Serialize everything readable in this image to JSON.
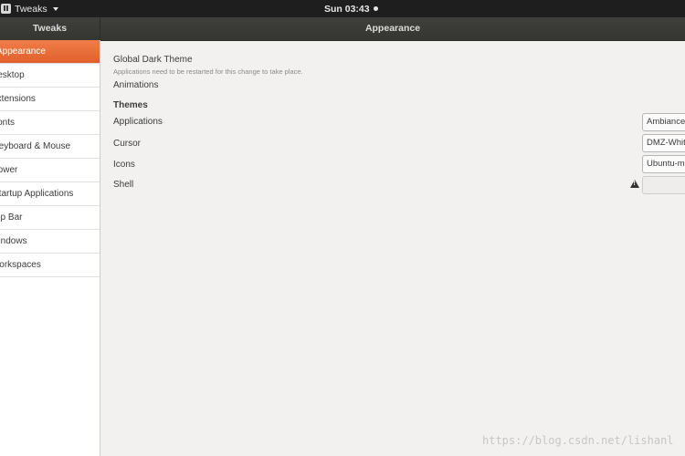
{
  "topbar": {
    "app_name": "Tweaks",
    "clock": "Sun 03:43"
  },
  "header": {
    "sidebar_title": "Tweaks",
    "main_title": "Appearance"
  },
  "sidebar": {
    "items": [
      {
        "label": "Appearance",
        "active": true
      },
      {
        "label": "Desktop"
      },
      {
        "label": "Extensions"
      },
      {
        "label": "Fonts"
      },
      {
        "label": "Keyboard & Mouse"
      },
      {
        "label": "Power"
      },
      {
        "label": "Startup Applications"
      },
      {
        "label": "Top Bar"
      },
      {
        "label": "Windows"
      },
      {
        "label": "Workspaces"
      }
    ]
  },
  "main": {
    "global_dark_theme": "Global Dark Theme",
    "restart_note": "Applications need to be restarted for this change to take place.",
    "animations": "Animations",
    "themes_heading": "Themes",
    "applications_label": "Applications",
    "applications_value": "Ambiance",
    "cursor_label": "Cursor",
    "cursor_value": "DMZ-White",
    "icons_label": "Icons",
    "icons_value": "Ubuntu-mono-dark",
    "shell_label": "Shell",
    "shell_value": ""
  },
  "watermark": "https://blog.csdn.net/lishanl"
}
